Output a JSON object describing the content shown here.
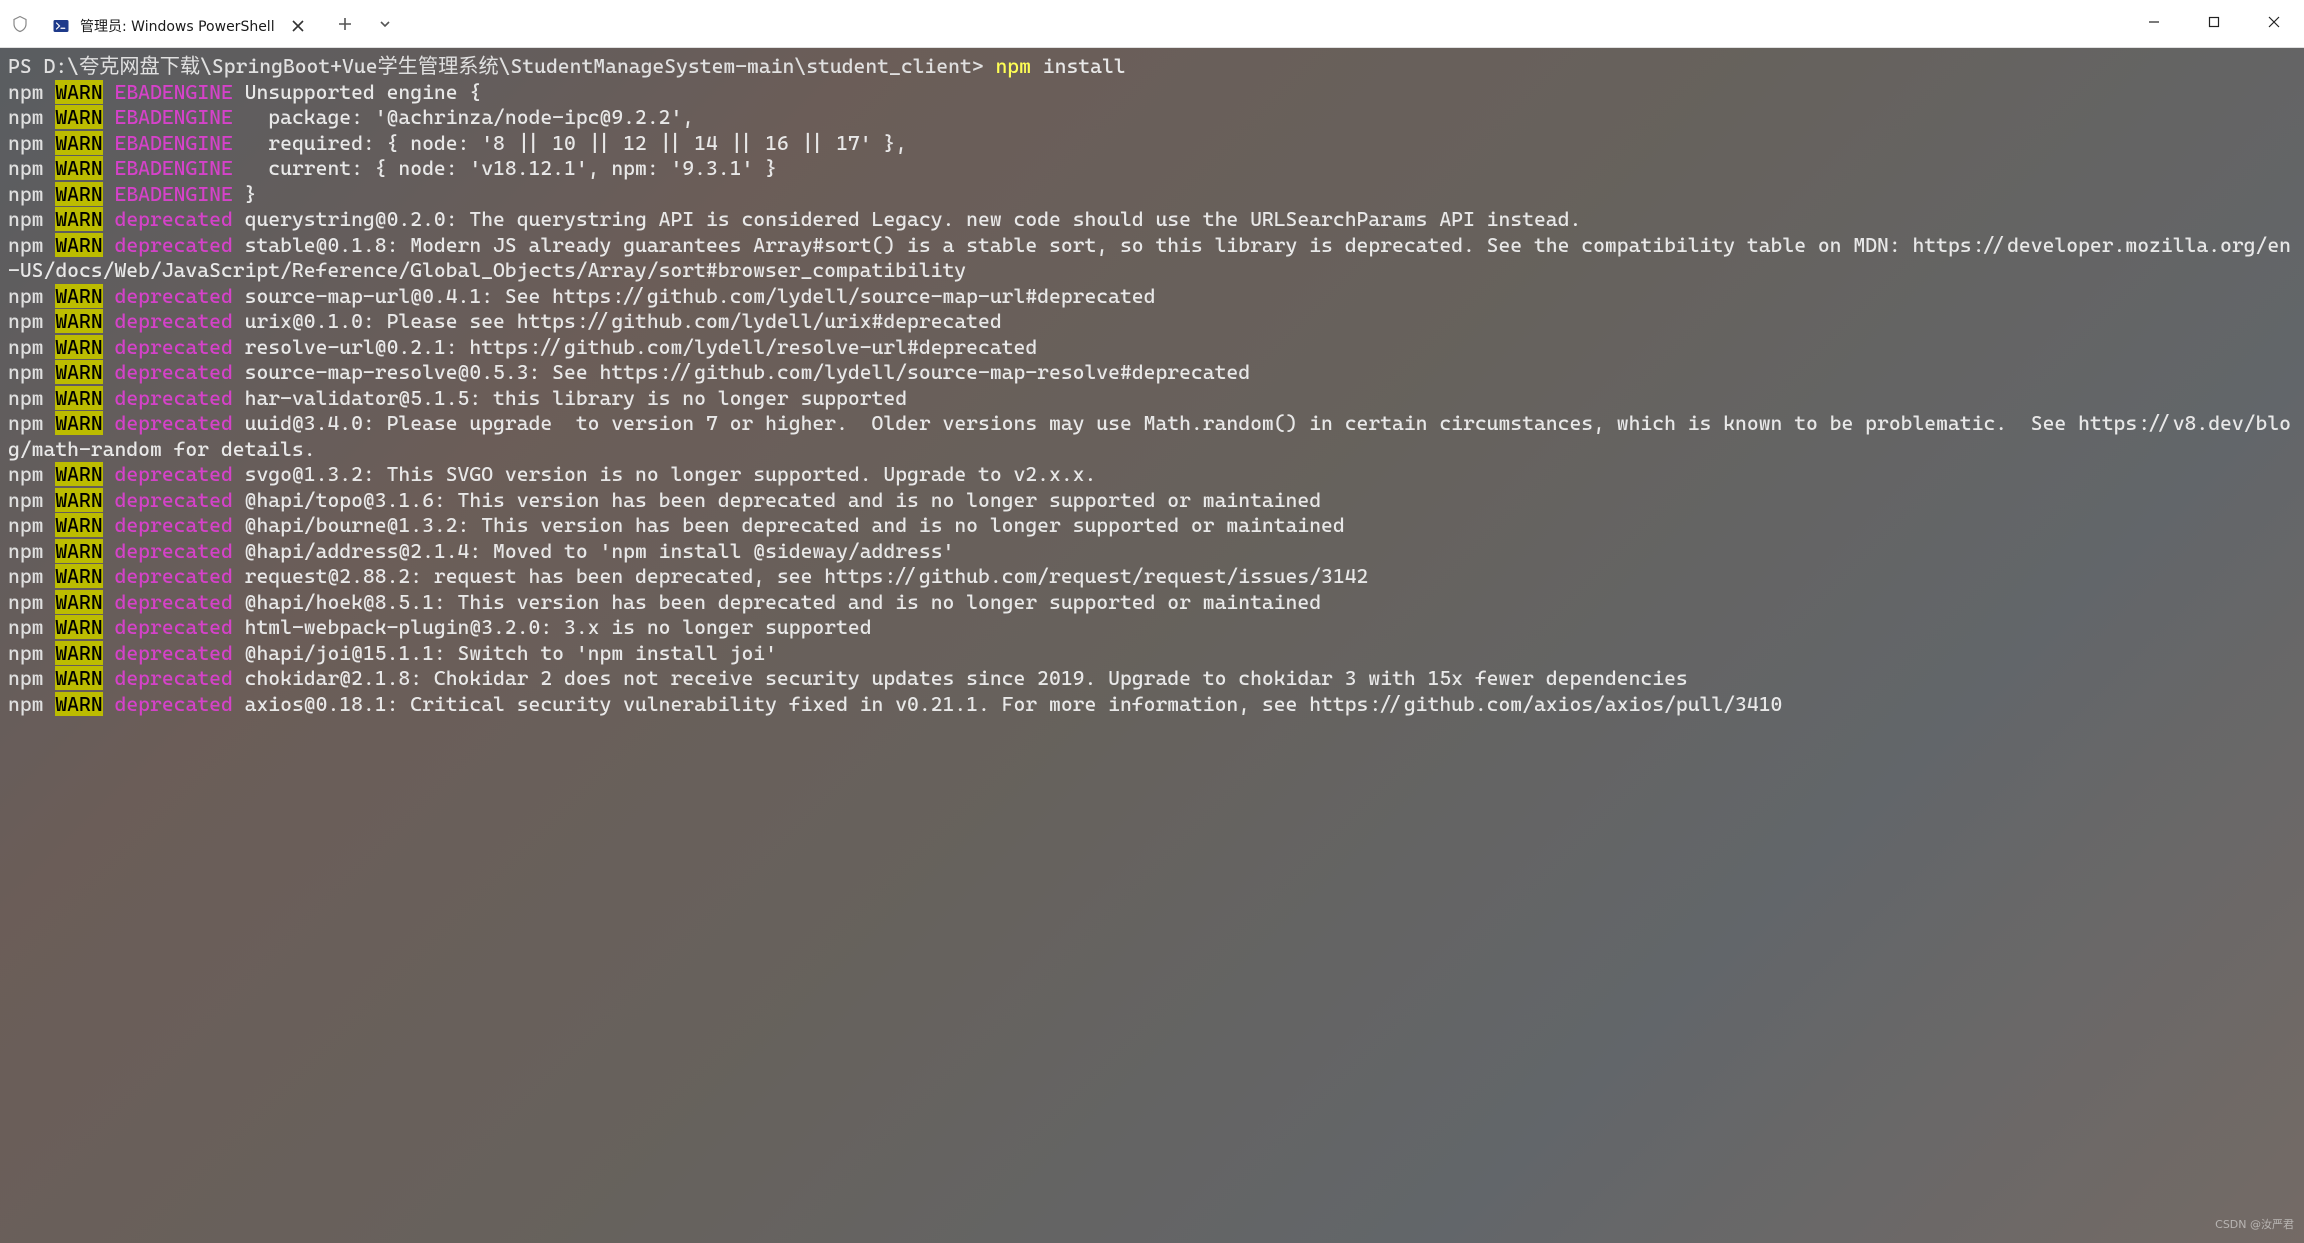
{
  "window": {
    "tab_title": "管理员: Windows PowerShell"
  },
  "prompt": {
    "path": "PS D:\\夸克网盘下载\\SpringBoot+Vue学生管理系统\\StudentManageSystem-main\\student_client> ",
    "cmd": "npm",
    "args": " install"
  },
  "labels": {
    "npm": "npm",
    "warn": "WARN",
    "ebadengine": "EBADENGINE",
    "deprecated": "deprecated"
  },
  "engine": {
    "l1": " Unsupported engine {",
    "l2": "   package: '@achrinza/node-ipc@9.2.2',",
    "l3": "   required: { node: '8 || 10 || 12 || 14 || 16 || 17' },",
    "l4": "   current: { node: 'v18.12.1', npm: '9.3.1' }",
    "l5": " }"
  },
  "dep": {
    "querystring": " querystring@0.2.0: The querystring API is considered Legacy. new code should use the URLSearchParams API instead.",
    "stable": " stable@0.1.8: Modern JS already guarantees Array#sort() is a stable sort, so this library is deprecated. See the compatibility table on MDN: https://developer.mozilla.org/en-US/docs/Web/JavaScript/Reference/Global_Objects/Array/sort#browser_compatibility",
    "sourcemapurl": " source-map-url@0.4.1: See https://github.com/lydell/source-map-url#deprecated",
    "urix": " urix@0.1.0: Please see https://github.com/lydell/urix#deprecated",
    "resolveurl": " resolve-url@0.2.1: https://github.com/lydell/resolve-url#deprecated",
    "sourcemapresolve": " source-map-resolve@0.5.3: See https://github.com/lydell/source-map-resolve#deprecated",
    "harvalidator": " har-validator@5.1.5: this library is no longer supported",
    "uuid": " uuid@3.4.0: Please upgrade  to version 7 or higher.  Older versions may use Math.random() in certain circumstances, which is known to be problematic.  See https://v8.dev/blog/math-random for details.",
    "svgo": " svgo@1.3.2: This SVGO version is no longer supported. Upgrade to v2.x.x.",
    "hapitopo": " @hapi/topo@3.1.6: This version has been deprecated and is no longer supported or maintained",
    "hapibourne": " @hapi/bourne@1.3.2: This version has been deprecated and is no longer supported or maintained",
    "hapiaddress": " @hapi/address@2.1.4: Moved to 'npm install @sideway/address'",
    "request": " request@2.88.2: request has been deprecated, see https://github.com/request/request/issues/3142",
    "hapihoek": " @hapi/hoek@8.5.1: This version has been deprecated and is no longer supported or maintained",
    "htmlwebpack": " html-webpack-plugin@3.2.0: 3.x is no longer supported",
    "hapijoi": " @hapi/joi@15.1.1: Switch to 'npm install joi'",
    "chokidar": " chokidar@2.1.8: Chokidar 2 does not receive security updates since 2019. Upgrade to chokidar 3 with 15x fewer dependencies",
    "axios": " axios@0.18.1: Critical security vulnerability fixed in v0.21.1. For more information, see https://github.com/axios/axios/pull/3410"
  },
  "watermark": "CSDN @汝严君"
}
